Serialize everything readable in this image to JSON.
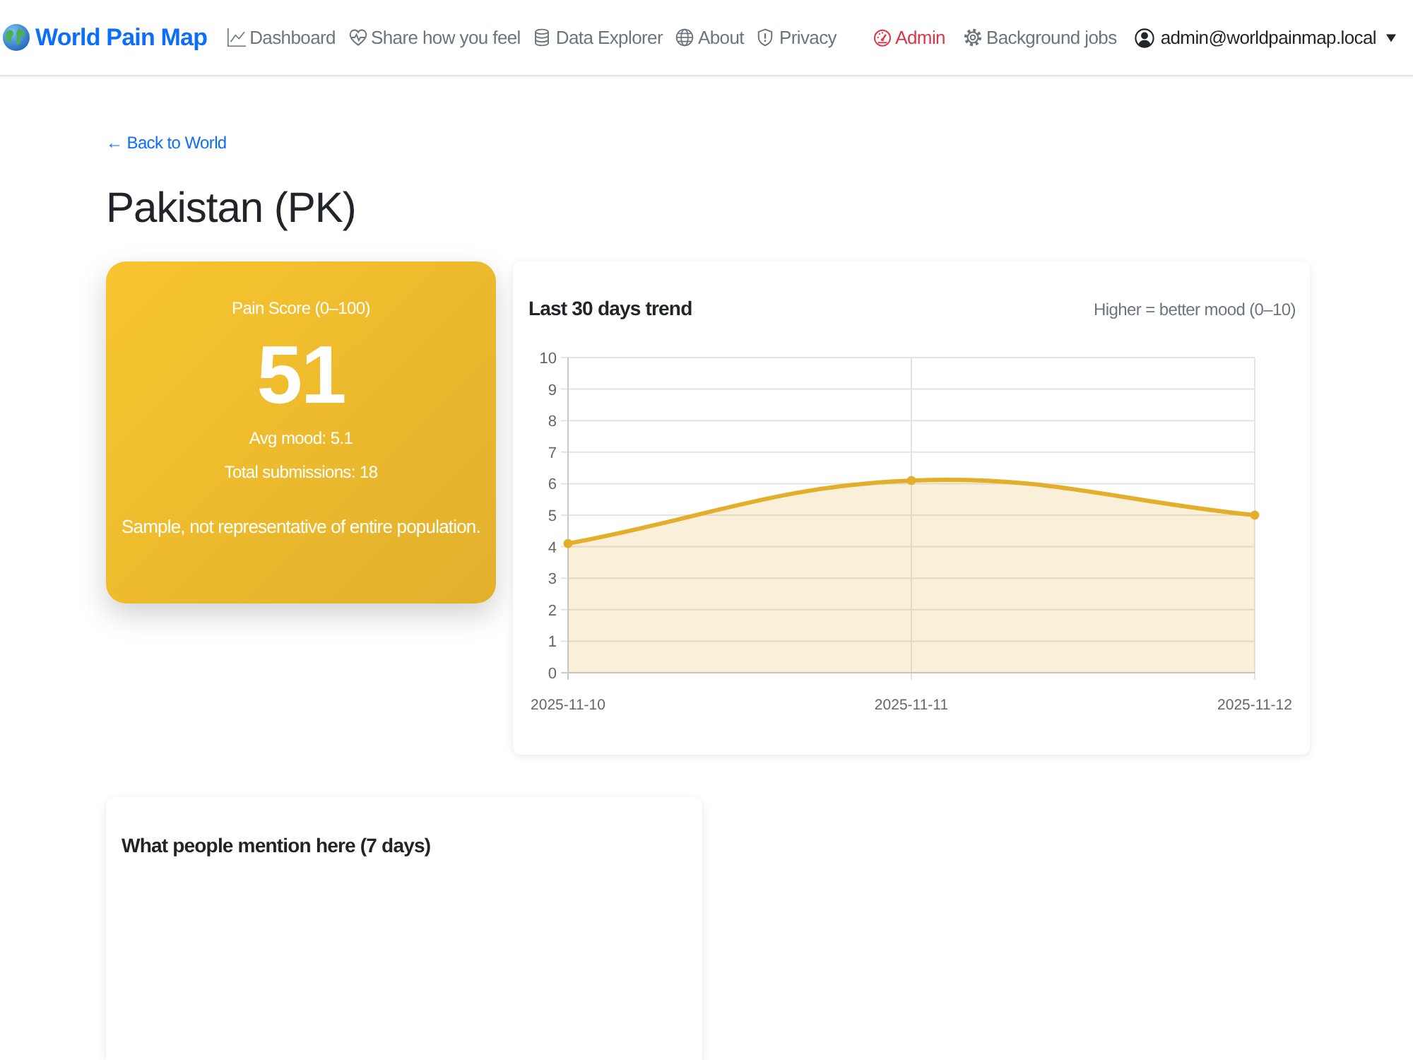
{
  "navbar": {
    "brand": "World Pain Map",
    "links": [
      {
        "label": "Dashboard"
      },
      {
        "label": "Share how you feel"
      },
      {
        "label": "Data Explorer"
      },
      {
        "label": "About"
      },
      {
        "label": "Privacy"
      }
    ],
    "right_links": [
      {
        "label": "Admin",
        "color": "#dc3545"
      },
      {
        "label": "Background jobs",
        "color": "#6c757d"
      }
    ],
    "user": {
      "label": "admin@worldpainmap.local"
    }
  },
  "back_link": "← Back to World",
  "title": "Pakistan (PK)",
  "score_card": {
    "label": "Pain Score (0–100)",
    "score": "51",
    "avg_mood": "Avg mood: 5.1",
    "submissions": "Total submissions: 18",
    "note": "Sample, not representative of entire population."
  },
  "trend_card": {
    "title": "Last 30 days trend",
    "hint": "Higher = better mood (0–10)",
    "chart_data": {
      "type": "area",
      "categories": [
        "2025-11-10",
        "2025-11-11",
        "2025-11-12"
      ],
      "series": [
        {
          "color": "#e3ae2a",
          "values": [
            4.1,
            6.1,
            5.0
          ]
        }
      ],
      "ylim": [
        0,
        10
      ],
      "yticks": [
        0,
        1,
        2,
        3,
        4,
        5,
        6,
        7,
        8,
        9,
        10
      ],
      "grid": true
    }
  },
  "mentions_card": {
    "title": "What people mention here (7 days)"
  }
}
